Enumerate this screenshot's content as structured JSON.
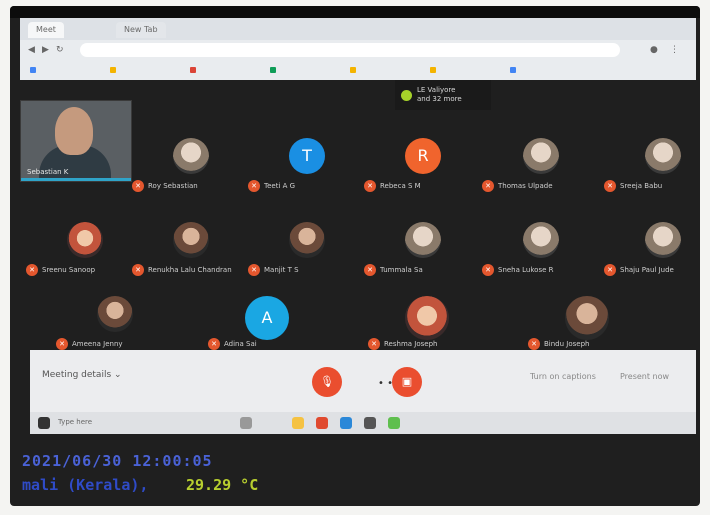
{
  "browser": {
    "tabs": [
      {
        "label": "Meet"
      },
      {
        "label": "New Tab"
      }
    ],
    "address": "",
    "bookmarks": [
      "",
      "",
      "",
      "",
      "",
      "",
      ""
    ]
  },
  "meeting_info": {
    "title": "LE Valiyore",
    "subtitle": "and 32 more"
  },
  "self_view": {
    "label": "Sebastian K"
  },
  "participants": [
    {
      "name": "Roy Sebastian",
      "initial": "",
      "style": "photo2"
    },
    {
      "name": "Teeti A G",
      "initial": "T",
      "color": "#1a8fe3"
    },
    {
      "name": "Rebeca S M",
      "initial": "R",
      "color": "#f0642d"
    },
    {
      "name": "Thomas Ulpade",
      "initial": "",
      "style": "photo2"
    },
    {
      "name": "Sreeja Babu",
      "initial": "",
      "style": "photo2"
    },
    {
      "name": "Sreenu Sanoop",
      "initial": "",
      "style": "photo3"
    },
    {
      "name": "Renukha Lalu Chandran",
      "initial": "",
      "style": "photo"
    },
    {
      "name": "Manjit T S",
      "initial": "",
      "style": "photo"
    },
    {
      "name": "Tummala Sa",
      "initial": "",
      "style": "photo2"
    },
    {
      "name": "Sneha Lukose R",
      "initial": "",
      "style": "photo2"
    },
    {
      "name": "Shaju Paul Jude",
      "initial": "",
      "style": "photo2"
    },
    {
      "name": "Ameena Jenny",
      "initial": "",
      "style": "photo"
    },
    {
      "name": "Adina Sai",
      "initial": "A",
      "color": "#1aa7e3"
    },
    {
      "name": "Reshma Joseph",
      "initial": "",
      "style": "photo3"
    },
    {
      "name": "Bindu Joseph",
      "initial": "",
      "style": "photo"
    }
  ],
  "controls": {
    "details_label": "Meeting details",
    "mic_icon": "mic-off-icon",
    "hangup_icon": "phone-icon",
    "camera_icon": "camera-off-icon",
    "more_label": "• •",
    "captions_label": "Turn on captions",
    "present_label": "Present now"
  },
  "taskbar": {
    "search_label": "Type here",
    "tray_text": ""
  },
  "overlay": {
    "datetime": "2021/06/30 12:00:05",
    "location": "mali (Kerala),",
    "temperature": "29.29 °C"
  },
  "colors": {
    "red_button": "#ea4e2f",
    "date_blue": "#4a62d6",
    "temp_green": "#b8cf2f"
  }
}
